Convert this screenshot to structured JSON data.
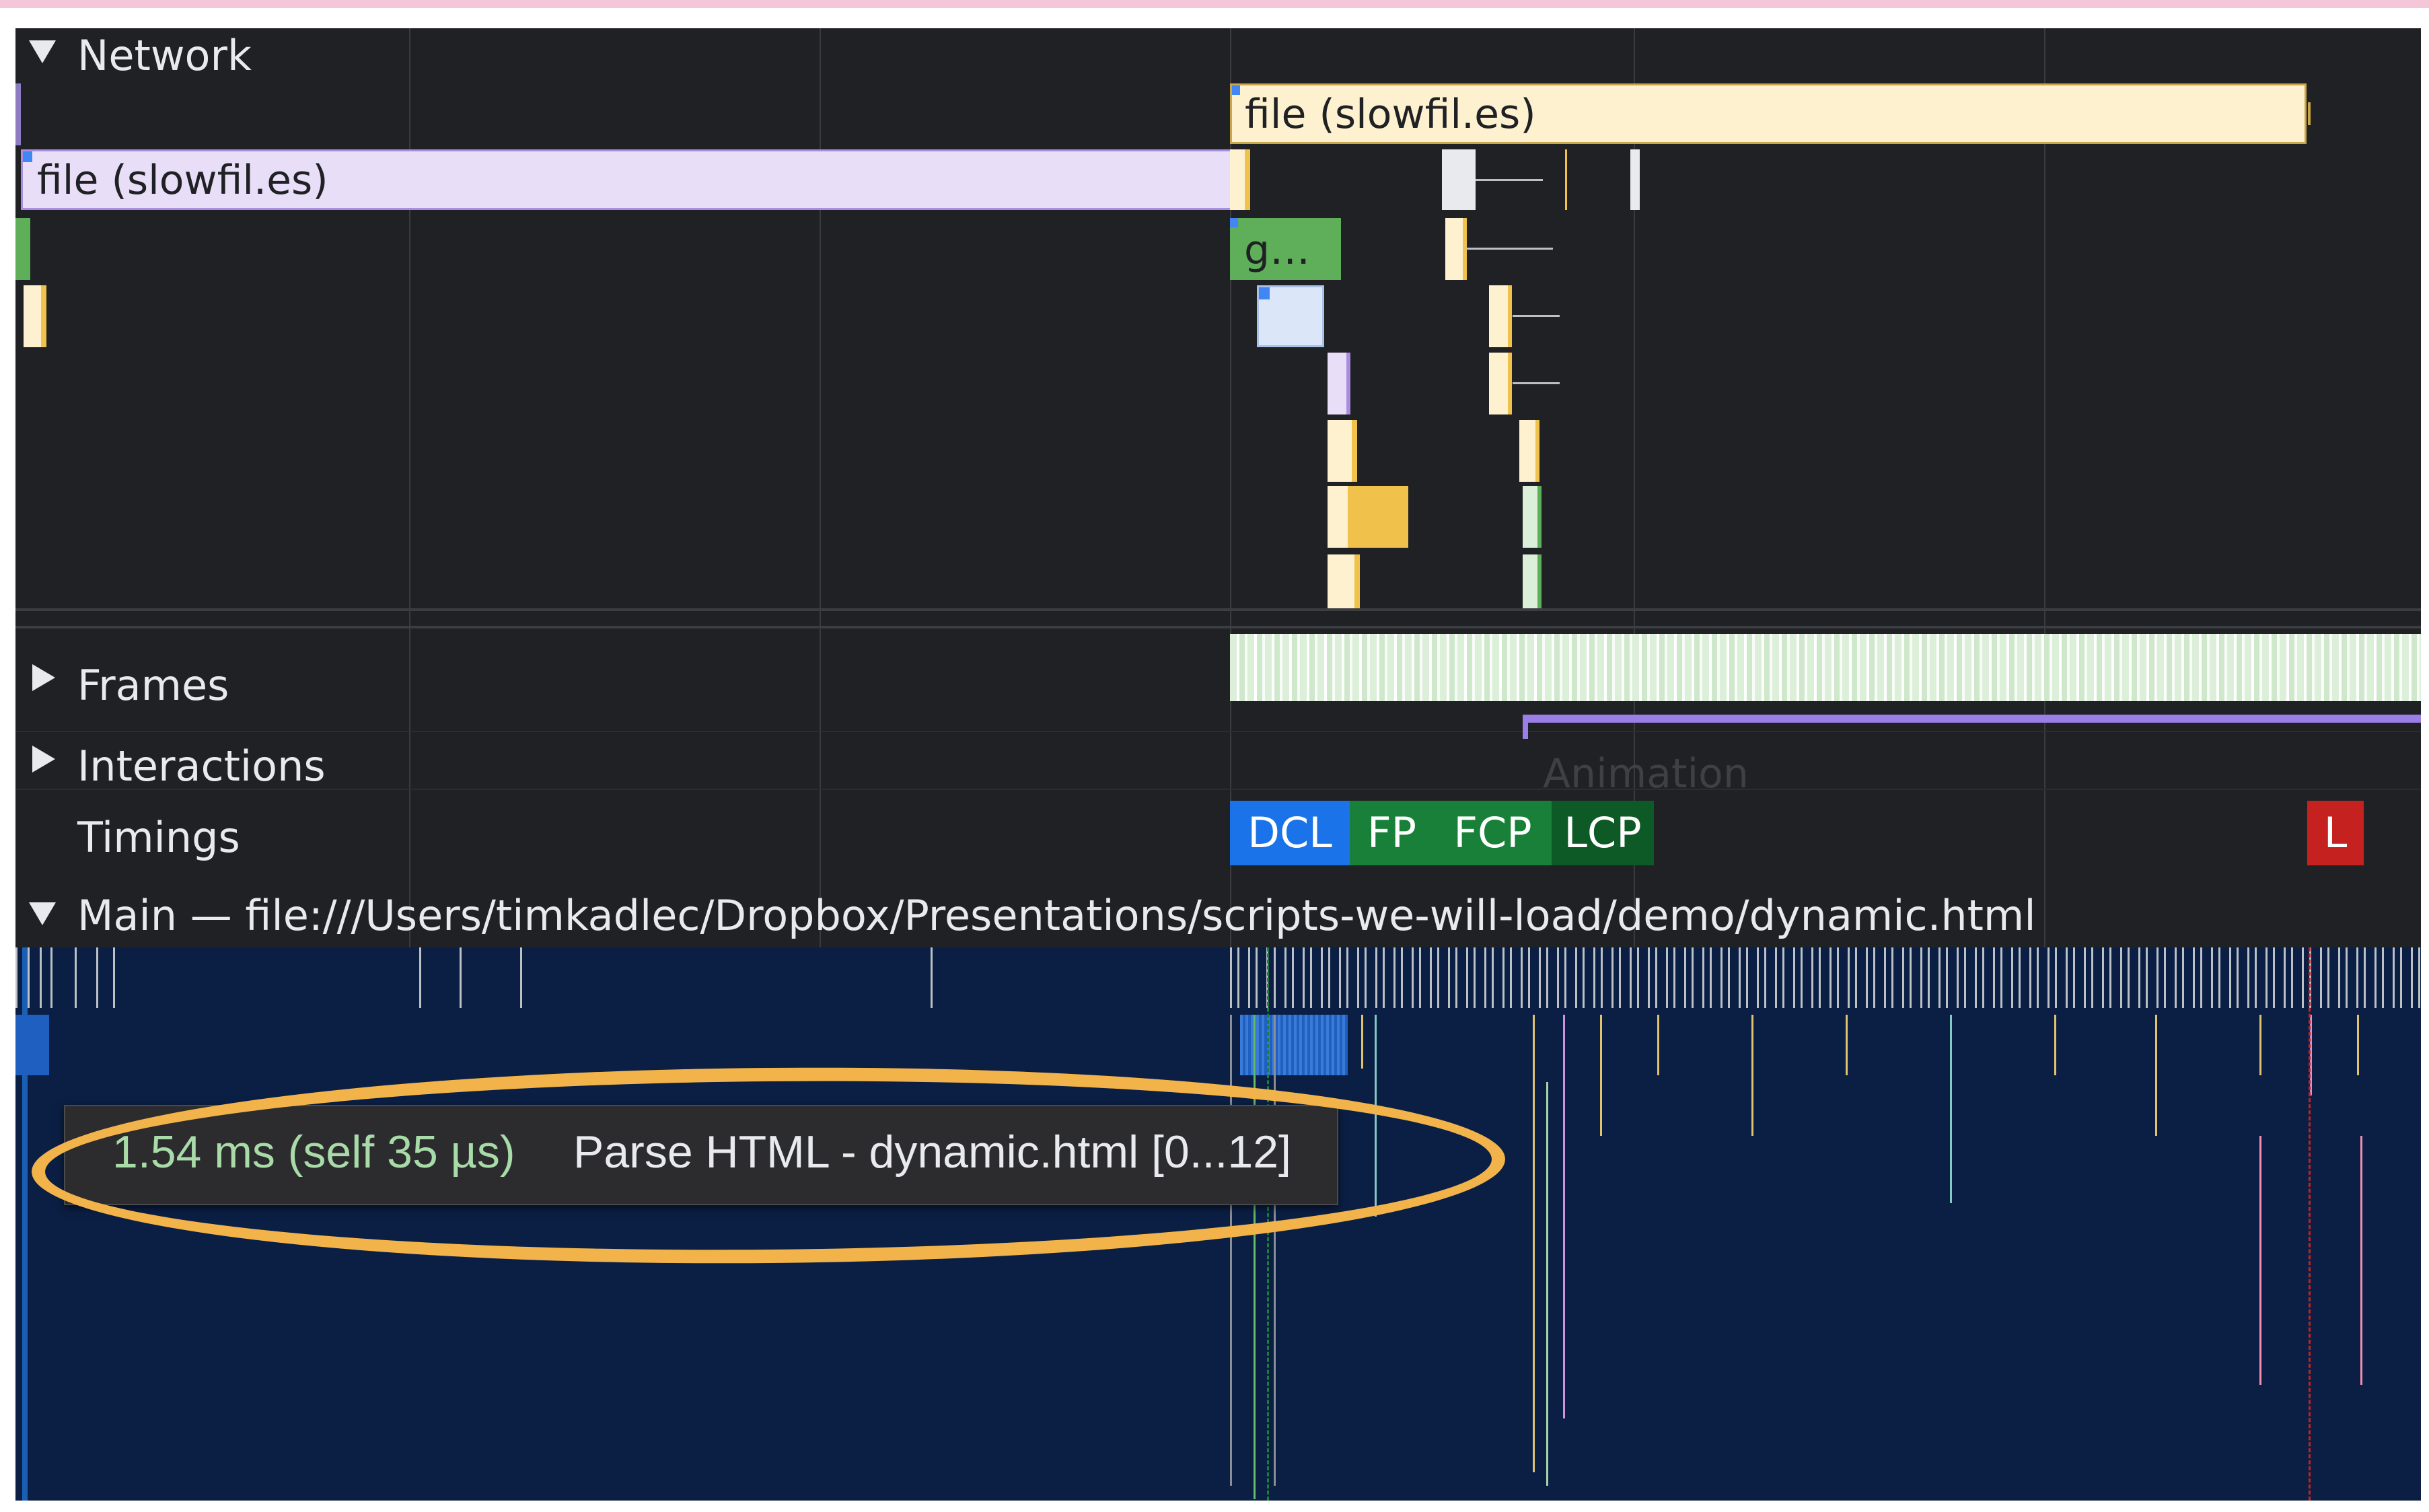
{
  "tracks": {
    "network": "Network",
    "frames": "Frames",
    "interactions": "Interactions",
    "timings": "Timings",
    "main_label": "Main — file:///Users/timkadlec/Dropbox/Presentations/scripts-we-will-load/demo/dynamic.html"
  },
  "network_requests": {
    "request_1": "file (slowfil.es)",
    "request_2": "file (slowfil.es)",
    "request_3": "g…"
  },
  "interactions": {
    "animation_label": "Animation"
  },
  "timing_markers": {
    "dcl": "DCL",
    "fp": "FP",
    "fcp": "FCP",
    "lcp": "LCP",
    "load": "L"
  },
  "more_indicator": "...",
  "tooltip": {
    "duration": "1.54 ms (self 35 µs)",
    "event": "Parse HTML - dynamic.html [0...12]"
  },
  "colors": {
    "panel_bg": "#202124",
    "main_bg": "#0b1f45",
    "request_yellow": "#fdf1d0",
    "request_purple": "#e9def8",
    "dcl": "#1a73e8",
    "paint_green": "#188038",
    "lcp": "#0d5a26",
    "load": "#c5221f",
    "highlight_oval": "#f2b44a"
  }
}
